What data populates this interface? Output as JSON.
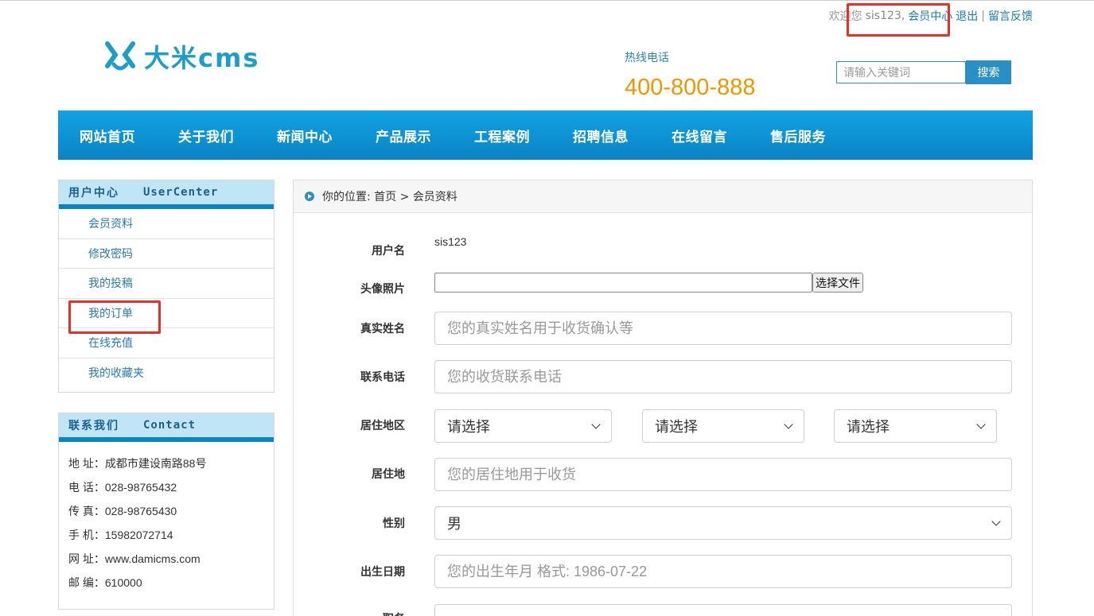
{
  "header": {
    "welcome_prefix": "欢迎您",
    "username": "sis123,",
    "member_center": "会员中心",
    "logout": "退出",
    "separator": "|",
    "feedback": "留言反馈",
    "logo_text": "大米cms",
    "hotline_label": "热线电话",
    "hotline_number": "400-800-888",
    "search_placeholder": "请输入关键词",
    "search_button": "搜索"
  },
  "nav": {
    "items": [
      "网站首页",
      "关于我们",
      "新闻中心",
      "产品展示",
      "工程案例",
      "招聘信息",
      "在线留言",
      "售后服务"
    ]
  },
  "user_center": {
    "title_cn": "用户中心",
    "title_en": "UserCenter",
    "items": [
      "会员资料",
      "修改密码",
      "我的投稿",
      "我的订单",
      "在线充值",
      "我的收藏夹"
    ]
  },
  "contact": {
    "title_cn": "联系我们",
    "title_en": "Contact",
    "lines": [
      "地  址：成都市建设南路88号",
      "电  话：028-98765432",
      "传  真：028-98765430",
      "手  机：15982072714",
      "网  址：www.damicms.com",
      "邮  编：610000"
    ]
  },
  "breadcrumb": {
    "prefix": "你的位置:",
    "home": "首页",
    "sep": ">",
    "current": "会员资料"
  },
  "form": {
    "username_label": "用户名",
    "username_value": "sis123",
    "avatar_label": "头像照片",
    "file_button": "选择文件",
    "realname_label": "真实姓名",
    "realname_placeholder": "您的真实姓名用于收货确认等",
    "phone_label": "联系电话",
    "phone_placeholder": "您的收货联系电话",
    "region_label": "居住地区",
    "region_select_1": "请选择",
    "region_select_2": "请选择",
    "region_select_3": "请选择",
    "address_label": "居住地",
    "address_placeholder": "您的居住地用于收货",
    "gender_label": "性别",
    "gender_value": "男",
    "birthday_label": "出生日期",
    "birthday_placeholder": "您的出生年月 格式: 1986-07-22",
    "next_label": "职务"
  },
  "colors": {
    "accent": "#0b84c6",
    "highlight": "#e8302a",
    "hotline": "#f29600"
  }
}
